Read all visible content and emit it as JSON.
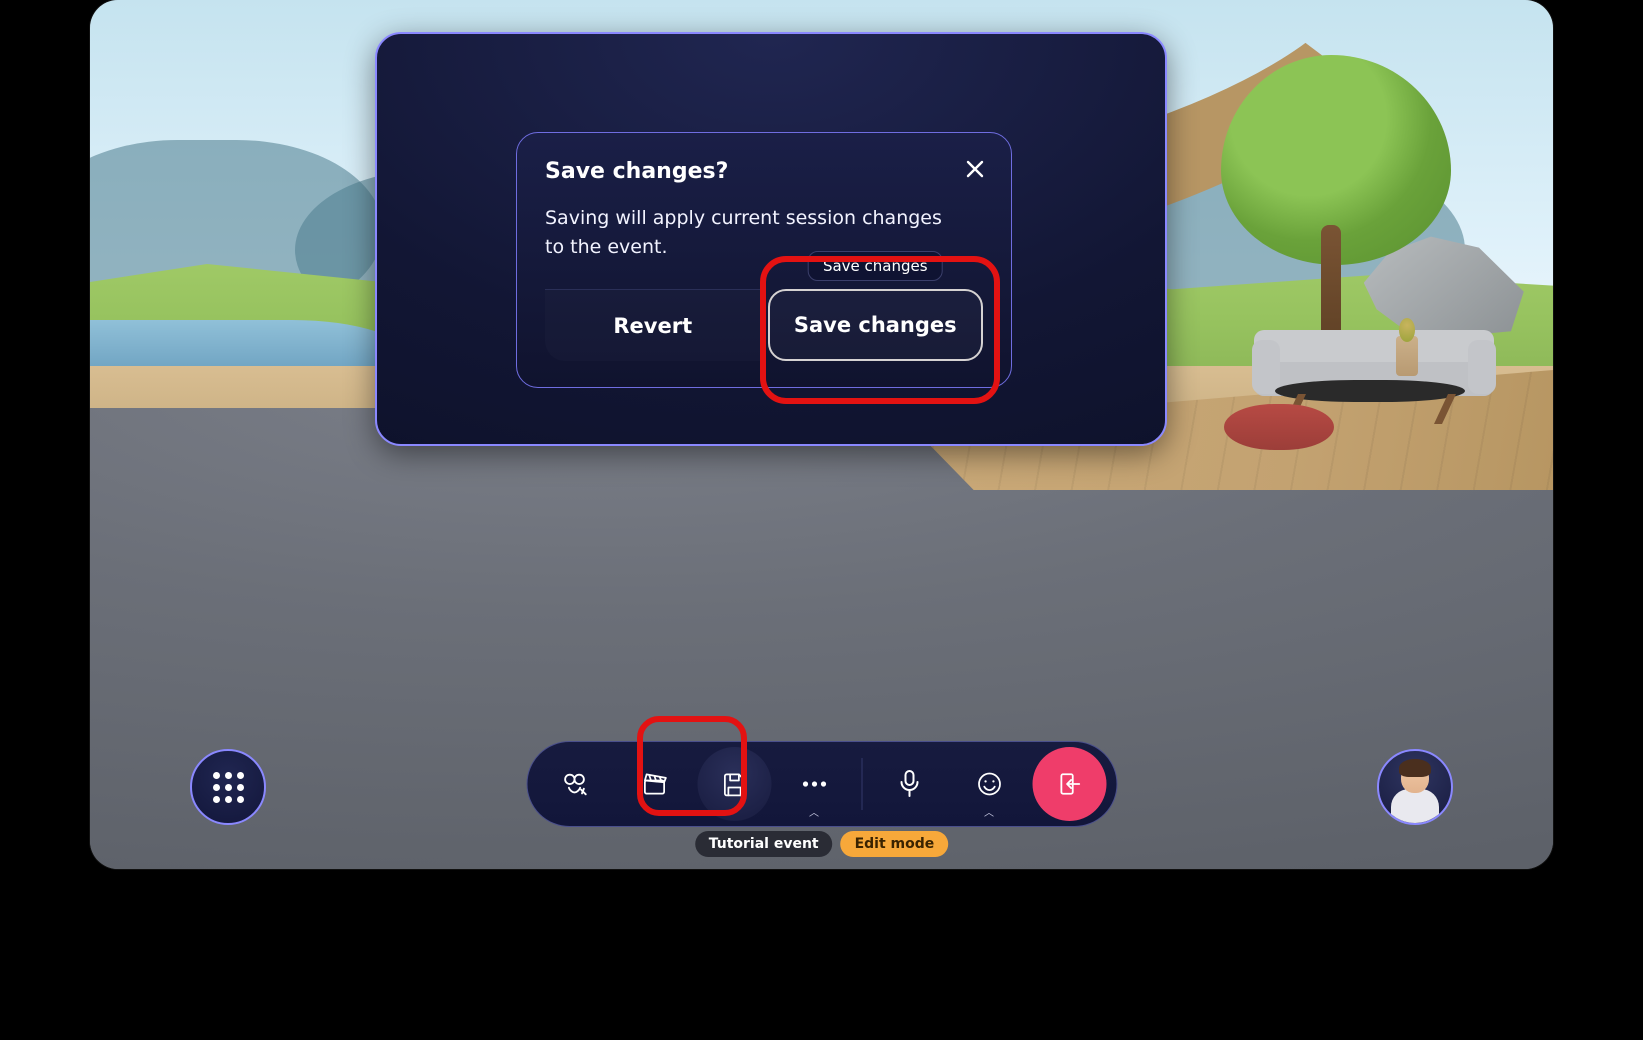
{
  "dialog": {
    "title": "Save changes?",
    "body": "Saving will apply current session changes to the event.",
    "revert_label": "Revert",
    "save_label": "Save changes",
    "tooltip": "Save changes"
  },
  "toolbar": {
    "items": [
      {
        "name": "customize-icon",
        "interactable": true
      },
      {
        "name": "clapperboard-icon",
        "interactable": true
      },
      {
        "name": "save-icon",
        "interactable": true,
        "active": true
      },
      {
        "name": "more-icon",
        "interactable": true,
        "caret": true
      },
      {
        "name": "microphone-icon",
        "interactable": true
      },
      {
        "name": "emoji-icon",
        "interactable": true,
        "caret": true
      },
      {
        "name": "leave-icon",
        "interactable": true,
        "leave": true
      }
    ]
  },
  "pills": {
    "event_label": "Tutorial event",
    "mode_label": "Edit mode"
  },
  "corners": {
    "menu_label": "app-menu",
    "avatar_label": "user-avatar"
  },
  "colors": {
    "highlight": "#e31212",
    "leave": "#ef3d6a",
    "edit_mode": "#f7a83a",
    "panel_border": "#8a88ff"
  }
}
